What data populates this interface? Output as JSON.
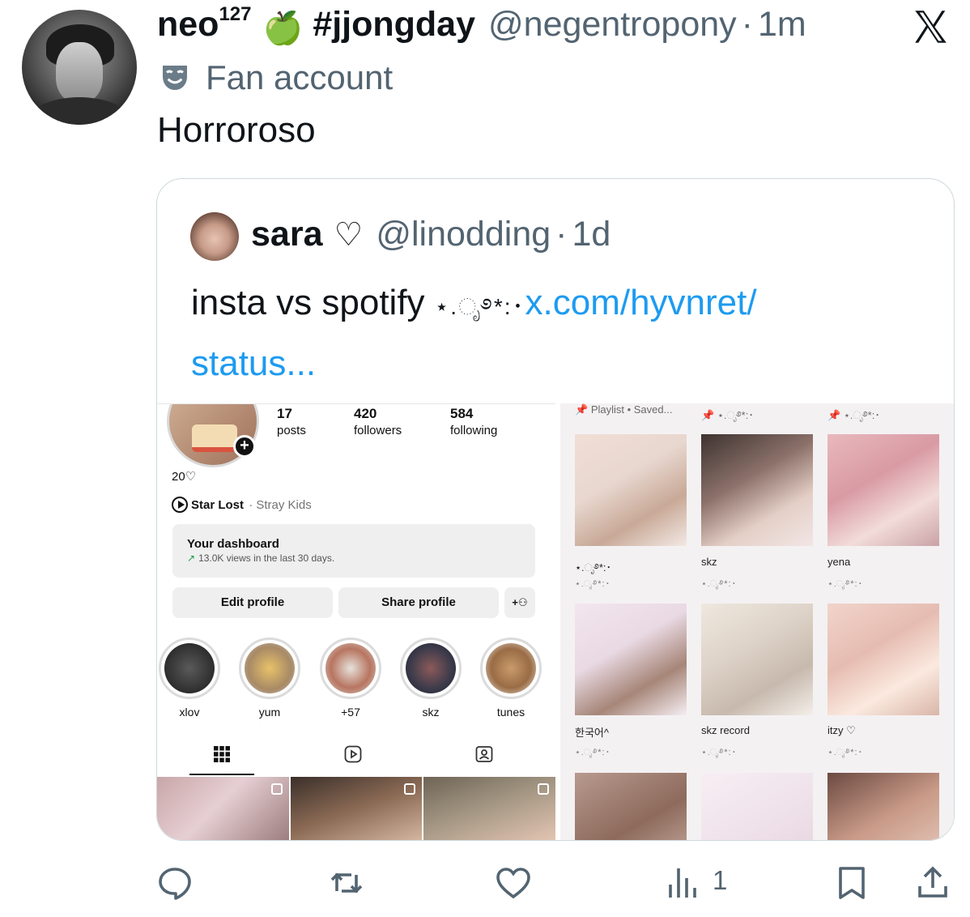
{
  "tweet": {
    "author": {
      "display_name": "neo",
      "superscript": "127",
      "emoji": "🍏",
      "name_hashtag": "#jjongday",
      "handle": "@negentropony",
      "time": "1m"
    },
    "label": "Fan account",
    "text": "Horroroso"
  },
  "quote": {
    "name": "sara",
    "heart": "♡",
    "handle": "@linodding",
    "time": "1d",
    "text": "insta vs spotify ",
    "sparkle": "⋆.ೃ࿔*:･",
    "link_line1": "x.com/hyvnret/",
    "link_line2": "status..."
  },
  "instagram": {
    "stats": [
      {
        "num": "17",
        "label": "posts"
      },
      {
        "num": "420",
        "label": "followers"
      },
      {
        "num": "584",
        "label": "following"
      }
    ],
    "bio": "20♡",
    "song": {
      "title": "Star Lost",
      "separator": "·",
      "artist": "Stray Kids"
    },
    "dashboard": {
      "title": "Your dashboard",
      "arrow": "↗",
      "sub": "13.0K views in the last 30 days."
    },
    "buttons": {
      "edit": "Edit profile",
      "share": "Share profile",
      "add": "+⚇"
    },
    "highlights": [
      {
        "label": "xlov"
      },
      {
        "label": "yum"
      },
      {
        "label": "+57"
      },
      {
        "label": "skz"
      },
      {
        "label": "tunes"
      }
    ]
  },
  "spotify": {
    "top_labels": [
      "Playlist • Saved...",
      "⋆.ೃ࿔*:･",
      "⋆.ೃ࿔*:･"
    ],
    "playlists": [
      {
        "title": "⋆.ೃ࿔*:･",
        "sub": "⋆.ೃ࿔*:･"
      },
      {
        "title": "skz",
        "sub": "⋆.ೃ࿔*:･"
      },
      {
        "title": "yena",
        "sub": "⋆.ೃ࿔*:･"
      },
      {
        "title": "한국어^",
        "sub": "⋆.ೃ࿔*:･"
      },
      {
        "title": "skz record",
        "sub": "⋆.ೃ࿔*:･"
      },
      {
        "title": "itzy ♡",
        "sub": "⋆.ೃ࿔*:･"
      }
    ]
  },
  "actions": {
    "views_count": "1"
  },
  "colors": {
    "text_primary": "#0f1419",
    "text_secondary": "#536471",
    "link": "#1d9bf0",
    "border": "#cfd9de"
  }
}
